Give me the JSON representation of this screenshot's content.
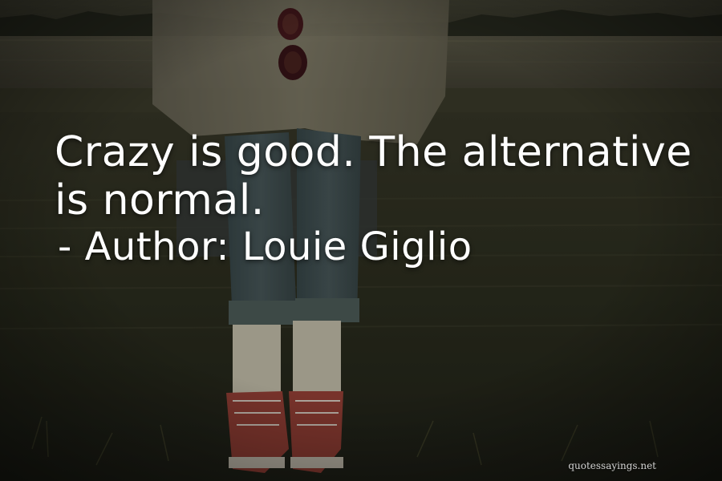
{
  "quote": {
    "line1": "Crazy is good. The alternative",
    "line2": "is normal."
  },
  "author": {
    "prefix": "- Author:",
    "name": "Louie Giglio"
  },
  "watermark": "quotessayings.net"
}
